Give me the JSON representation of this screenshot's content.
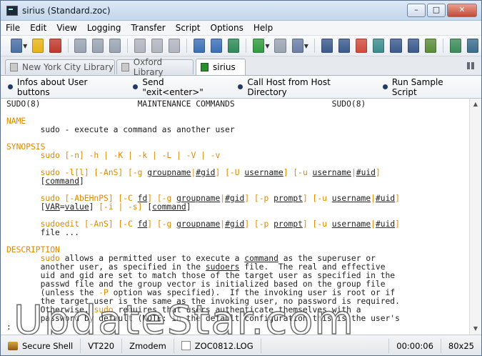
{
  "window": {
    "title": "sirius (Standard.zoc)",
    "minimize": "–",
    "maximize": "□",
    "close": "✕"
  },
  "menu": [
    "File",
    "Edit",
    "View",
    "Logging",
    "Transfer",
    "Script",
    "Options",
    "Help"
  ],
  "toolbar": {
    "icons": [
      {
        "name": "session-icon",
        "color": "#4a6fa5",
        "dropdown": true
      },
      {
        "name": "star-icon",
        "color": "#e7b416"
      },
      {
        "name": "disconnect-icon",
        "color": "#c0392b"
      },
      {
        "name": "sep"
      },
      {
        "name": "document-icon",
        "color": "#9aa4b1"
      },
      {
        "name": "close-doc-icon",
        "color": "#9aa4b1"
      },
      {
        "name": "print-icon",
        "color": "#9aa4b1"
      },
      {
        "name": "sep"
      },
      {
        "name": "copy-icon",
        "color": "#b0b6bf"
      },
      {
        "name": "clipboard-icon",
        "color": "#b0b6bf"
      },
      {
        "name": "paste-icon",
        "color": "#b0b6bf"
      },
      {
        "name": "sep"
      },
      {
        "name": "refresh-icon",
        "color": "#3b6fb6"
      },
      {
        "name": "upload-icon",
        "color": "#3b6fb6"
      },
      {
        "name": "download-icon",
        "color": "#2e8b57"
      },
      {
        "name": "sep"
      },
      {
        "name": "play-icon",
        "color": "#2e9b3e",
        "dropdown": true
      },
      {
        "name": "stop-icon",
        "color": "#9aa4b1"
      },
      {
        "name": "edit-icon",
        "color": "#6b7fa6",
        "dropdown": true
      },
      {
        "name": "sep"
      },
      {
        "name": "keyboard-icon",
        "color": "#3a5a8c"
      },
      {
        "name": "font-icon",
        "color": "#3a5a8c"
      },
      {
        "name": "color-icon",
        "color": "#d04a3a"
      },
      {
        "name": "layout-icon",
        "color": "#3a8c8c"
      },
      {
        "name": "network-icon",
        "color": "#3a5a8c"
      },
      {
        "name": "phone-icon",
        "color": "#3a5a8c"
      },
      {
        "name": "settings-icon",
        "color": "#5a8c3a"
      },
      {
        "name": "sep"
      },
      {
        "name": "tools-icon",
        "color": "#3a8c5a"
      },
      {
        "name": "script-icon",
        "color": "#3a6c8c"
      }
    ]
  },
  "tabs": [
    {
      "label": "New York City Library",
      "active": false
    },
    {
      "label": "Oxford Library",
      "active": false
    },
    {
      "label": "sirius",
      "active": true
    }
  ],
  "user_buttons": [
    "Infos about User buttons",
    "Send \"exit<enter>\"",
    "Call Host from Host Directory",
    "Run Sample Script"
  ],
  "terminal": {
    "lines": [
      [
        {
          "t": "SUDO(8)                    MAINTENANCE COMMANDS                    SUDO(8)"
        }
      ],
      [
        {
          "t": ""
        }
      ],
      [
        {
          "t": "NAME",
          "c": "o"
        }
      ],
      [
        {
          "t": "       sudo - execute a command as another user"
        }
      ],
      [
        {
          "t": ""
        }
      ],
      [
        {
          "t": "SYNOPSIS",
          "c": "o"
        }
      ],
      [
        {
          "t": "       "
        },
        {
          "t": "sudo [-n] -h | -K | -k | -L | -V | -v",
          "c": "o"
        }
      ],
      [
        {
          "t": ""
        }
      ],
      [
        {
          "t": "       "
        },
        {
          "t": "sudo -l[l] [-AnS] [-g ",
          "c": "o"
        },
        {
          "t": "groupname",
          "u": true
        },
        {
          "t": "|",
          "c": "o"
        },
        {
          "t": "#gid",
          "u": true
        },
        {
          "t": "] [-U ",
          "c": "o"
        },
        {
          "t": "username",
          "u": true
        },
        {
          "t": "] [-u ",
          "c": "o"
        },
        {
          "t": "username",
          "u": true
        },
        {
          "t": "|",
          "c": "o"
        },
        {
          "t": "#uid",
          "u": true
        },
        {
          "t": "]",
          "c": "o"
        }
      ],
      [
        {
          "t": "       ["
        },
        {
          "t": "command",
          "u": true
        },
        {
          "t": "]"
        }
      ],
      [
        {
          "t": ""
        }
      ],
      [
        {
          "t": "       "
        },
        {
          "t": "sudo [-AbEHnPS] [-C ",
          "c": "o"
        },
        {
          "t": "fd",
          "u": true
        },
        {
          "t": "] [-g ",
          "c": "o"
        },
        {
          "t": "groupname",
          "u": true
        },
        {
          "t": "|",
          "c": "o"
        },
        {
          "t": "#gid",
          "u": true
        },
        {
          "t": "] [-p ",
          "c": "o"
        },
        {
          "t": "prompt",
          "u": true
        },
        {
          "t": "] [-u ",
          "c": "o"
        },
        {
          "t": "username",
          "u": true
        },
        {
          "t": "|",
          "c": "o"
        },
        {
          "t": "#uid",
          "u": true
        },
        {
          "t": "]",
          "c": "o"
        }
      ],
      [
        {
          "t": "       ["
        },
        {
          "t": "VAR",
          "u": true
        },
        {
          "t": "="
        },
        {
          "t": "value",
          "u": true
        },
        {
          "t": "] "
        },
        {
          "t": "[-i | -s]",
          "c": "o"
        },
        {
          "t": " ["
        },
        {
          "t": "command",
          "u": true
        },
        {
          "t": "]"
        }
      ],
      [
        {
          "t": ""
        }
      ],
      [
        {
          "t": "       "
        },
        {
          "t": "sudoedit [-AnS] [-C ",
          "c": "o"
        },
        {
          "t": "fd",
          "u": true
        },
        {
          "t": "] [-g ",
          "c": "o"
        },
        {
          "t": "groupname",
          "u": true
        },
        {
          "t": "|",
          "c": "o"
        },
        {
          "t": "#gid",
          "u": true
        },
        {
          "t": "] [-p ",
          "c": "o"
        },
        {
          "t": "prompt",
          "u": true
        },
        {
          "t": "] [-u ",
          "c": "o"
        },
        {
          "t": "username",
          "u": true
        },
        {
          "t": "|",
          "c": "o"
        },
        {
          "t": "#uid",
          "u": true
        },
        {
          "t": "]",
          "c": "o"
        }
      ],
      [
        {
          "t": "       file ..."
        }
      ],
      [
        {
          "t": ""
        }
      ],
      [
        {
          "t": "DESCRIPTION",
          "c": "o"
        }
      ],
      [
        {
          "t": "       "
        },
        {
          "t": "sudo",
          "c": "o"
        },
        {
          "t": " allows a permitted user to execute a "
        },
        {
          "t": "command",
          "u": true
        },
        {
          "t": " as the superuser or"
        }
      ],
      [
        {
          "t": "       another user, as specified in the "
        },
        {
          "t": "sudoers",
          "u": true
        },
        {
          "t": " file.  The real and effective"
        }
      ],
      [
        {
          "t": "       uid and gid are set to match those of the target user as specified in the"
        }
      ],
      [
        {
          "t": "       passwd file and the group vector is initialized based on the group file"
        }
      ],
      [
        {
          "t": "       (unless the "
        },
        {
          "t": "-P",
          "c": "o"
        },
        {
          "t": " option was specified).  If the invoking user is root or if"
        }
      ],
      [
        {
          "t": "       the target user is the same as the invoking user, no password is required."
        }
      ],
      [
        {
          "t": "       Otherwise, "
        },
        {
          "t": "sudo",
          "c": "o"
        },
        {
          "t": " requires that users authenticate themselves with a"
        }
      ],
      [
        {
          "t": "       password by default (NOTE: in the default configuration this is the user's"
        }
      ],
      [
        {
          "t": ":"
        }
      ]
    ]
  },
  "watermark": "UpdateStar.com",
  "status": {
    "connection": "Secure Shell",
    "emulation": "VT220",
    "transfer": "Zmodem",
    "logfile": "ZOC0812.LOG",
    "timer": "00:00:06",
    "size": "80x25"
  }
}
